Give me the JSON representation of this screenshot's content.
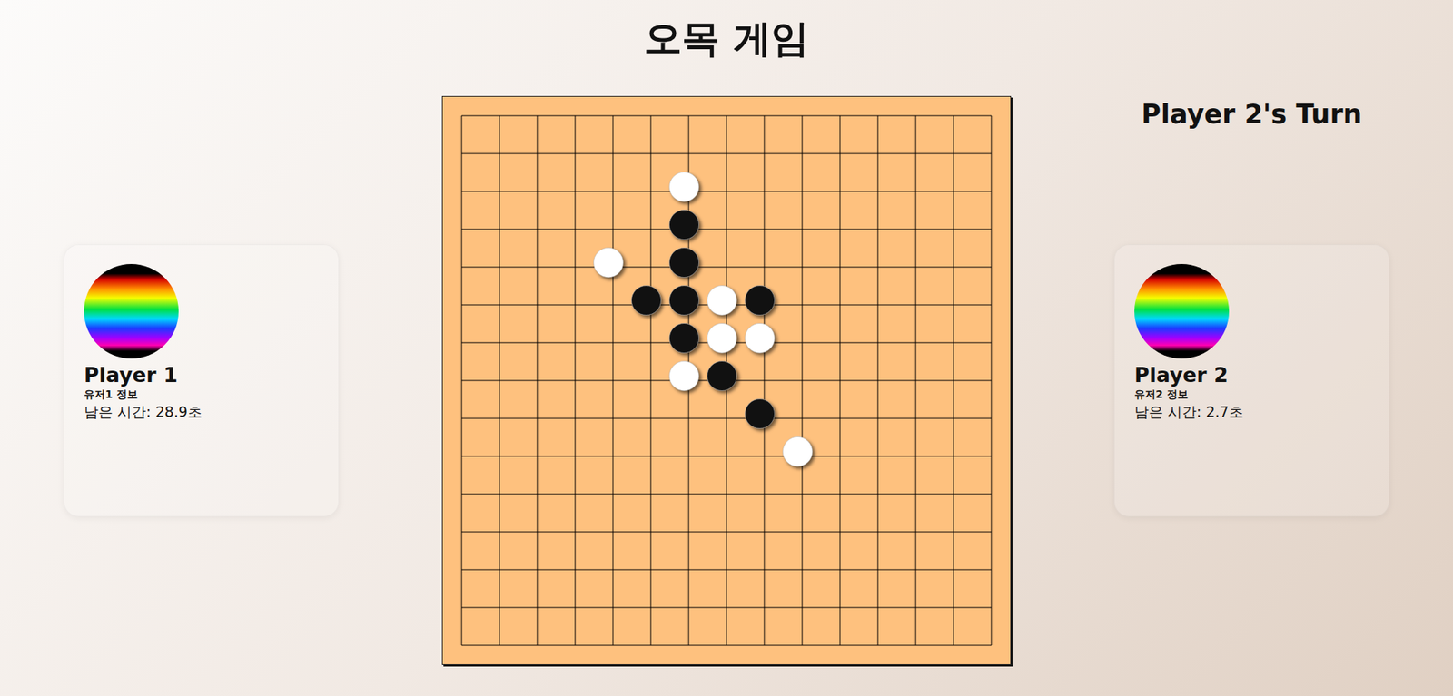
{
  "title": "오목 게임",
  "turn": "Player 2's Turn",
  "players": [
    {
      "name": "Player 1",
      "info": "유저1 정보",
      "time": "남은 시간: 28.9초"
    },
    {
      "name": "Player 2",
      "info": "유저2 정보",
      "time": "남은 시간: 2.7초"
    }
  ],
  "board": {
    "lines": 15,
    "stones": [
      {
        "col": 6,
        "row": 2,
        "color": "#ffffff"
      },
      {
        "col": 6,
        "row": 3,
        "color": "#111111"
      },
      {
        "col": 6,
        "row": 4,
        "color": "#111111"
      },
      {
        "col": 4,
        "row": 4,
        "color": "#ffffff"
      },
      {
        "col": 5,
        "row": 5,
        "color": "#111111"
      },
      {
        "col": 6,
        "row": 5,
        "color": "#111111"
      },
      {
        "col": 7,
        "row": 5,
        "color": "#ffffff"
      },
      {
        "col": 8,
        "row": 5,
        "color": "#111111"
      },
      {
        "col": 6,
        "row": 6,
        "color": "#111111"
      },
      {
        "col": 7,
        "row": 6,
        "color": "#ffffff"
      },
      {
        "col": 8,
        "row": 6,
        "color": "#ffffff"
      },
      {
        "col": 6,
        "row": 7,
        "color": "#ffffff"
      },
      {
        "col": 7,
        "row": 7,
        "color": "#111111"
      },
      {
        "col": 8,
        "row": 8,
        "color": "#111111"
      },
      {
        "col": 9,
        "row": 9,
        "color": "#ffffff"
      }
    ]
  }
}
